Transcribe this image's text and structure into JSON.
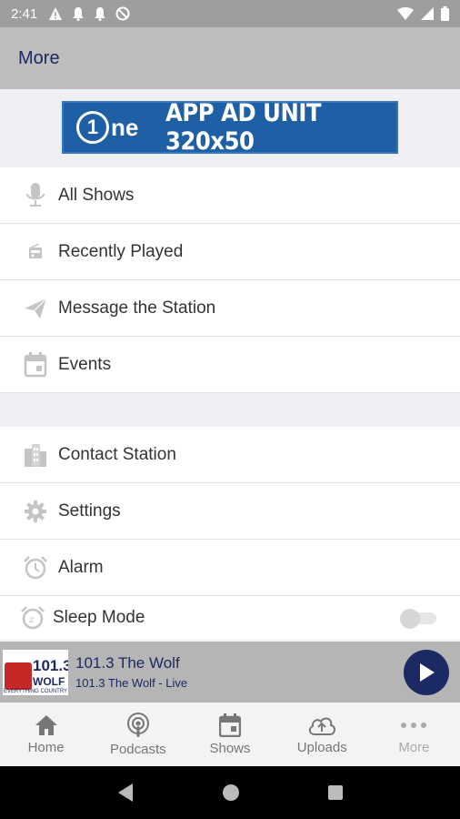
{
  "status_bar": {
    "time": "2:41"
  },
  "app_bar": {
    "title": "More"
  },
  "ad": {
    "logo_one": "1",
    "logo_ne": "ne",
    "text": "APP AD UNIT 320x50"
  },
  "menu_group_1": [
    {
      "label": "All Shows",
      "icon": "microphone-icon"
    },
    {
      "label": "Recently Played",
      "icon": "radio-icon"
    },
    {
      "label": "Message the Station",
      "icon": "send-icon"
    },
    {
      "label": "Events",
      "icon": "calendar-icon"
    }
  ],
  "menu_group_2": [
    {
      "label": "Contact Station",
      "icon": "building-icon"
    },
    {
      "label": "Settings",
      "icon": "gear-icon"
    },
    {
      "label": "Alarm",
      "icon": "alarm-icon"
    },
    {
      "label": "Sleep Mode",
      "icon": "sleep-icon",
      "toggle_on": false
    }
  ],
  "player": {
    "logo_freq": "101.3",
    "logo_name": "WOLF",
    "logo_tag": "EVERYTHING COUNTRY",
    "station_name": "101.3 The Wolf",
    "stream_name": "101.3 The Wolf - Live"
  },
  "bottom_nav": [
    {
      "label": "Home",
      "icon": "home-icon"
    },
    {
      "label": "Podcasts",
      "icon": "podcast-icon"
    },
    {
      "label": "Shows",
      "icon": "calendar-icon"
    },
    {
      "label": "Uploads",
      "icon": "cloud-upload-icon"
    },
    {
      "label": "More",
      "icon": "more-dots-icon"
    }
  ],
  "colors": {
    "accent": "#1b2a63",
    "ad_blue": "#1f5fa6"
  }
}
